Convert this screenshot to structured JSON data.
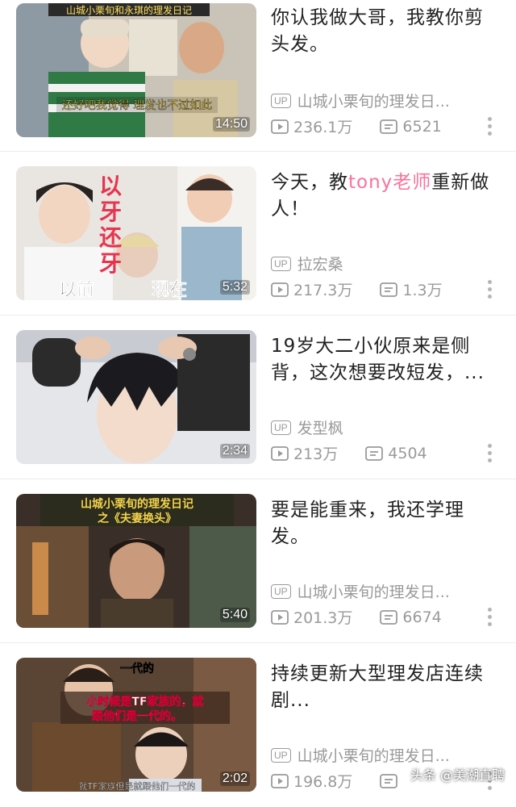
{
  "videos": [
    {
      "title": "你认我做大哥，我教你剪头发。",
      "title_parts": [
        "你认我做大哥，我教你剪头发。"
      ],
      "uploader": "山城小栗旬的理发日...",
      "views": "236.1万",
      "danmaku": "6521",
      "duration": "14:50",
      "overlay_top": "山城小栗旬和永琪的理发日记",
      "overlay_bottom": "还好吧我觉得 理发也不过如此"
    },
    {
      "title_pre": "今天，教",
      "title_hl": "tony老师",
      "title_post": "重新做人！",
      "uploader": "拉宏桑",
      "views": "217.3万",
      "danmaku": "1.3万",
      "duration": "5:32",
      "overlay_a": "以",
      "overlay_b": "牙",
      "overlay_c": "还",
      "overlay_d": "牙",
      "overlay_before": "以前",
      "overlay_now": "现在"
    },
    {
      "title": "19岁大二小伙原来是侧背，这次想要改短发，...",
      "uploader": "发型枫",
      "views": "213万",
      "danmaku": "4504",
      "duration": "2:34"
    },
    {
      "title": "要是能重来，我还学理发。",
      "uploader": "山城小栗旬的理发日...",
      "views": "201.3万",
      "danmaku": "6674",
      "duration": "5:40",
      "overlay_top": "山城小栗旬的理发日记",
      "overlay_sub": "之《夫妻换头》"
    },
    {
      "title": "持续更新大型理发店连续剧...",
      "uploader": "山城小栗旬的理发日...",
      "views": "196.8万",
      "danmaku": "",
      "duration": "2:02",
      "overlay_top": "一代的",
      "overlay_mid1": "小时候是TF家族的，就",
      "overlay_mid2": "跟他们是一代的。",
      "overlay_bottom": "就TF家族但是就跟他们一代的"
    }
  ],
  "up_badge": "UP",
  "watermark": "头条 @美潮直聘",
  "colors": {
    "accent": "#fb7299",
    "meta": "#9a9a9a",
    "title": "#222222"
  }
}
